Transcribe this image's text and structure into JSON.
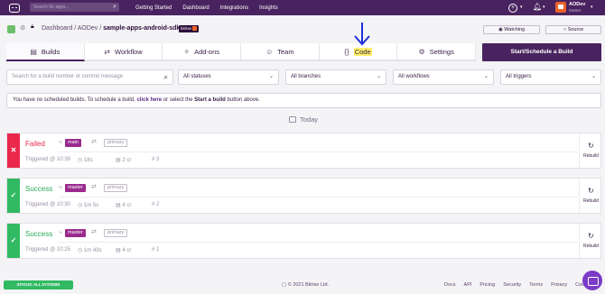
{
  "topnav": {
    "search_placeholder": "Search for apps...",
    "links": [
      "Getting Started",
      "Dashboard",
      "Integrations",
      "Insights"
    ],
    "user": {
      "name": "AODev",
      "role": "Owner"
    }
  },
  "breadcrumb": {
    "parts": [
      "Dashboard",
      "AODev"
    ],
    "app_name": "sample-apps-android-sdk22",
    "tag": "bitrise"
  },
  "header_buttons": {
    "watching": "Watching",
    "source": "Source"
  },
  "tabs": [
    {
      "label": "Builds",
      "icon": "builds-icon"
    },
    {
      "label": "Workflow",
      "icon": "workflow-icon"
    },
    {
      "label": "Add-ons",
      "icon": "addons-icon"
    },
    {
      "label": "Team",
      "icon": "team-icon"
    },
    {
      "label": "Code",
      "icon": "code-icon"
    },
    {
      "label": "Settings",
      "icon": "gear-icon"
    }
  ],
  "start_build": "Start/Schedule a Build",
  "filters": {
    "search_placeholder": "Search for a build number or commit message",
    "statuses": "All statuses",
    "branches": "All branches",
    "workflows": "All workflows",
    "triggers": "All triggers"
  },
  "info": {
    "prefix": "You have no scheduled builds. To schedule a build,",
    "link": "click here",
    "middle": "or select the",
    "bold": "Start a build",
    "suffix": "button above."
  },
  "today_label": "Today",
  "builds": [
    {
      "status": "Failed",
      "branch": "main",
      "workflow": "primary",
      "triggered": "Triggered @ 10:39",
      "duration": "18s",
      "stack": "2 cr",
      "number": "3",
      "rebuild": "Rebuild"
    },
    {
      "status": "Success",
      "branch": "master",
      "workflow": "primary",
      "triggered": "Triggered @ 10:30",
      "duration": "1m 5s",
      "stack": "4 cr",
      "number": "2",
      "rebuild": "Rebuild"
    },
    {
      "status": "Success",
      "branch": "master",
      "workflow": "primary",
      "triggered": "Triggered @ 10:25",
      "duration": "1m 43s",
      "stack": "4 cr",
      "number": "1",
      "rebuild": "Rebuild"
    }
  ],
  "footer": {
    "status_pill": "STATUS: ALL SYSTEMS OPERATIONAL",
    "copyright": "© 2021 Bitrise Ltd.",
    "links": [
      "Docs",
      "API",
      "Pricing",
      "Security",
      "Terms",
      "Privacy",
      "Cookie"
    ]
  },
  "colors": {
    "brand": "#49235f",
    "failed": "#e9284b",
    "success": "#32b963",
    "branch_tag": "#9a2a8e",
    "highlight": "#fff06a",
    "arrow": "#1f2fd6"
  }
}
